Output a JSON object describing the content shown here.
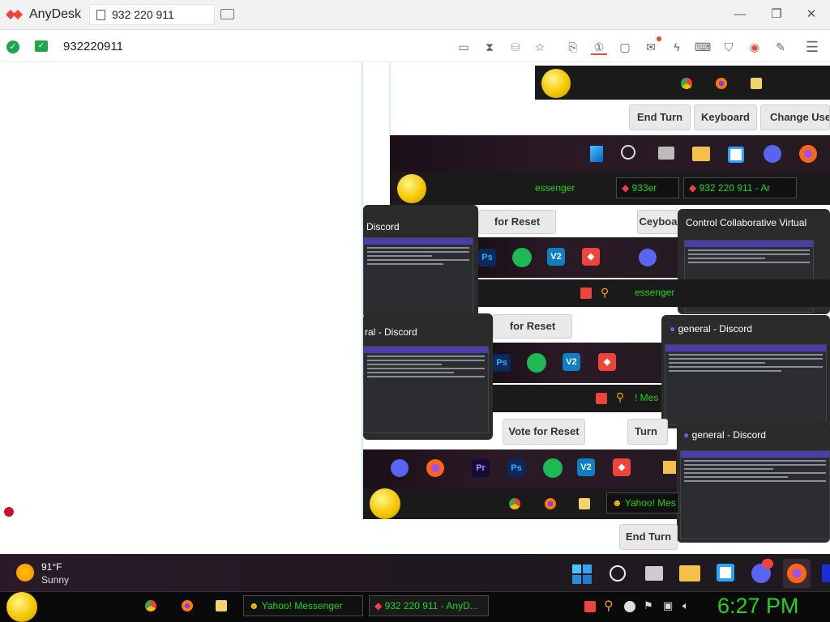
{
  "app": {
    "name": "AnyDesk",
    "tab_label": "932 220 911"
  },
  "window_controls": {
    "minimize": "—",
    "restore": "❐",
    "close": "✕"
  },
  "address": {
    "id": "932220911"
  },
  "toolbar_icons": [
    "display-icon",
    "hourglass-icon",
    "database-icon",
    "star-icon",
    "share-icon",
    "monitor-1-icon",
    "screen-icon",
    "chat-icon",
    "lightning-icon",
    "keyboard-icon",
    "shield-icon",
    "record-icon",
    "pen-icon",
    "menu-icon"
  ],
  "remote": {
    "buttons": {
      "end_turn": "End Turn",
      "keyboard": "Keyboard",
      "change_user": "Change Usern",
      "for_reset_1": "for Reset",
      "ceyboa": "Ceyboa",
      "for_reset_2": "for Reset",
      "vote_for_reset": "Vote for Reset",
      "turn": "Turn",
      "end_turn_2": "End Turn"
    },
    "labels": {
      "essenger": "essenger",
      "anydesk_933": "933er",
      "anydesk_full": "932 220 911 - Ar",
      "messenger_mid": "essenger",
      "yahoo_mes_mid": "! Mes",
      "yahoo_bottom": "Yahoo! Mes",
      "discord_1": "Discord",
      "discord_2": "ral - Discord",
      "discord_3": "general - Discord",
      "discord_4": "general - Discord",
      "control_collab": "Control Collaborative Virtual"
    },
    "icon_letters": {
      "ps": "Ps",
      "pr": "Pr",
      "vs": "V2"
    }
  },
  "weather": {
    "temp": "91°F",
    "condition": "Sunny"
  },
  "yahoo_taskbar": {
    "items": [
      "Yahoo! Messenger",
      "932 220 911 - AnyD..."
    ],
    "clock": "6:27 PM"
  },
  "colors": {
    "anydesk_red": "#ef443b",
    "ok_green": "#1ea64a",
    "clock_green": "#1fd41f"
  }
}
